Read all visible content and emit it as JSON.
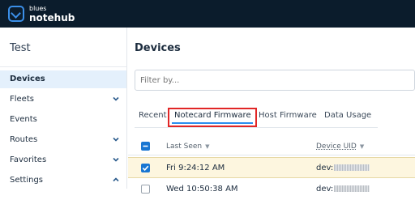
{
  "brand": {
    "line1": "blues",
    "line2": "notehub"
  },
  "sidebar": {
    "project": "Test",
    "items": [
      {
        "label": "Devices",
        "active": true
      },
      {
        "label": "Fleets",
        "chevron": "chevron-down-icon"
      },
      {
        "label": "Events"
      },
      {
        "label": "Routes",
        "chevron": "chevron-down-icon"
      },
      {
        "label": "Favorites",
        "chevron": "chevron-down-icon"
      },
      {
        "label": "Settings",
        "chevron": "chevron-up-icon"
      }
    ]
  },
  "main": {
    "title": "Devices",
    "filter_placeholder": "Filter by...",
    "tabs": [
      {
        "label": "Recent"
      },
      {
        "label": "Notecard Firmware",
        "active": true
      },
      {
        "label": "Host Firmware"
      },
      {
        "label": "Data Usage"
      }
    ]
  },
  "table": {
    "columns": {
      "last_seen": "Last Seen",
      "device_uid": "Device UID",
      "sort_caret": "▼"
    },
    "rows": [
      {
        "last_seen": "Fri 9:24:12 AM",
        "device_uid": "dev:",
        "checked": true
      },
      {
        "last_seen": "Wed 10:50:38 AM",
        "device_uid": "dev:",
        "checked": false
      }
    ]
  },
  "colors": {
    "topbar": "#0b1c2c",
    "accent": "#1976d2",
    "tab_highlight_box": "#e12626",
    "selected_row": "#fdf6df"
  }
}
